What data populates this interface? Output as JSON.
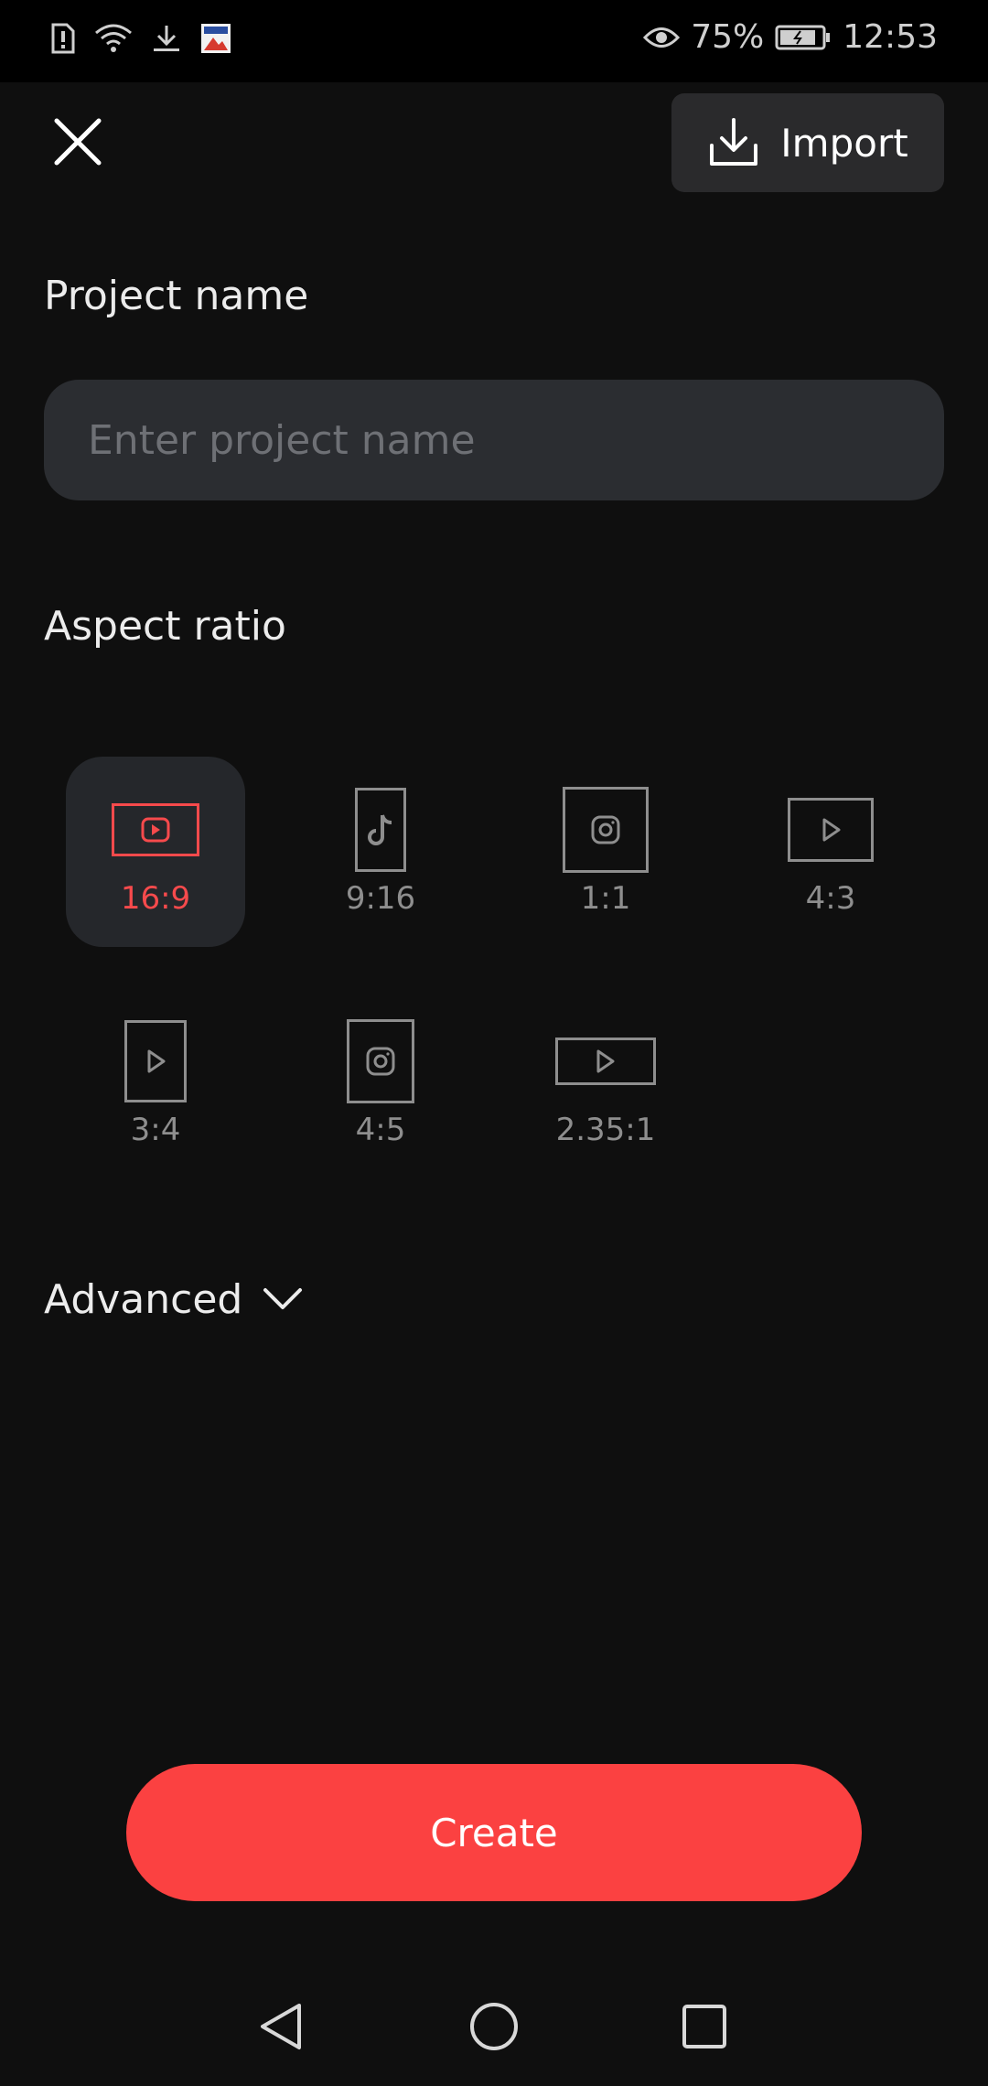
{
  "status_bar": {
    "battery": "75%",
    "time": "12:53",
    "icons": [
      "sim-alert-icon",
      "wifi-icon",
      "download-icon",
      "app-notification-icon",
      "eye-icon",
      "battery-icon"
    ]
  },
  "header": {
    "close_icon": "close-icon",
    "import_label": "Import",
    "import_icon": "download-tray-icon"
  },
  "project": {
    "label": "Project name",
    "placeholder": "Enter project name",
    "value": ""
  },
  "aspect": {
    "label": "Aspect ratio",
    "accent_color": "#f64a4c",
    "options": [
      {
        "label": "16:9",
        "icon": "youtube-icon",
        "selected": true
      },
      {
        "label": "9:16",
        "icon": "tiktok-icon",
        "selected": false
      },
      {
        "label": "1:1",
        "icon": "instagram-icon",
        "selected": false
      },
      {
        "label": "4:3",
        "icon": "play-icon",
        "selected": false
      },
      {
        "label": "3:4",
        "icon": "play-icon",
        "selected": false
      },
      {
        "label": "4:5",
        "icon": "instagram-icon",
        "selected": false
      },
      {
        "label": "2.35:1",
        "icon": "play-icon",
        "selected": false
      }
    ]
  },
  "advanced": {
    "label": "Advanced",
    "icon": "chevron-down-icon"
  },
  "create": {
    "label": "Create",
    "color": "#fb4141"
  },
  "navbar": {
    "icons": [
      "back-icon",
      "home-icon",
      "recents-icon"
    ]
  }
}
